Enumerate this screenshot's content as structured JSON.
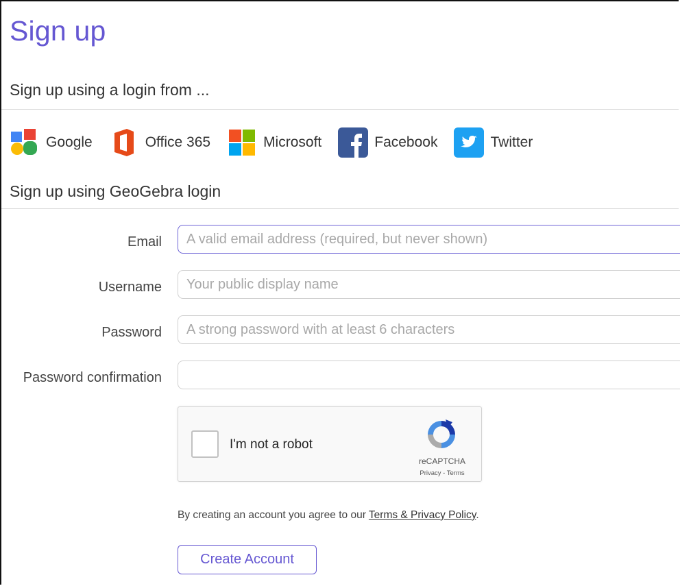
{
  "page": {
    "title": "Sign up"
  },
  "social": {
    "heading": "Sign up using a login from ...",
    "providers": [
      {
        "label": "Google",
        "icon": "google-icon"
      },
      {
        "label": "Office 365",
        "icon": "office-365-icon"
      },
      {
        "label": "Microsoft",
        "icon": "microsoft-icon"
      },
      {
        "label": "Facebook",
        "icon": "facebook-icon"
      },
      {
        "label": "Twitter",
        "icon": "twitter-icon"
      }
    ]
  },
  "form": {
    "heading": "Sign up using GeoGebra login",
    "email": {
      "label": "Email",
      "placeholder": "A valid email address (required, but never shown)",
      "value": ""
    },
    "username": {
      "label": "Username",
      "placeholder": "Your public display name",
      "value": ""
    },
    "password": {
      "label": "Password",
      "placeholder": "A strong password with at least 6 characters",
      "value": ""
    },
    "password_confirmation": {
      "label": "Password confirmation",
      "placeholder": "",
      "value": ""
    }
  },
  "captcha": {
    "label": "I'm not a robot",
    "brand": "reCAPTCHA",
    "links": "Privacy - Terms"
  },
  "agreement": {
    "prefix": "By creating an account you agree to our ",
    "link": "Terms & Privacy Policy",
    "suffix": "."
  },
  "submit": {
    "label": "Create Account"
  },
  "colors": {
    "accent": "#6557d2",
    "google": "#4285f4",
    "office": "#e64a19",
    "facebook": "#3b5998",
    "twitter": "#1da1f2"
  }
}
